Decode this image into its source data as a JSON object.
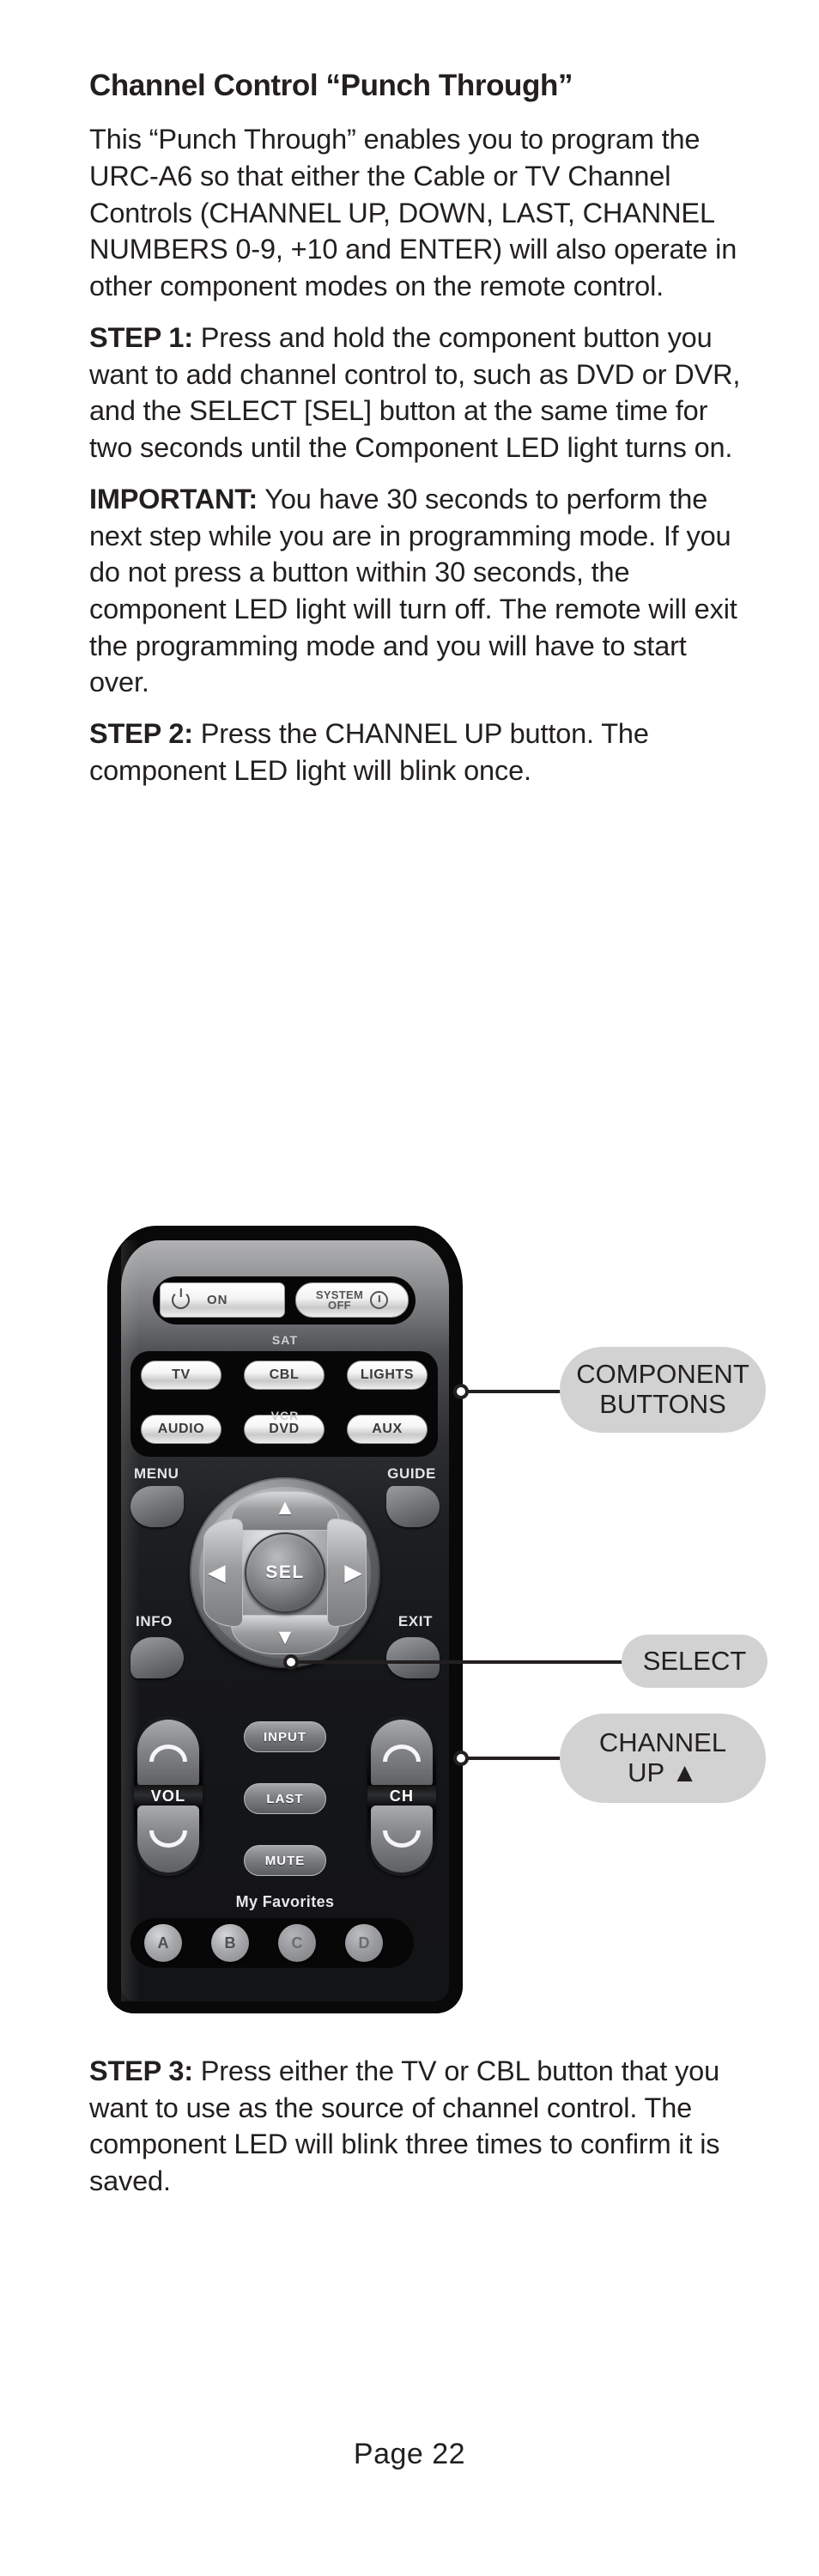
{
  "document": {
    "section_title": "Channel Control “Punch Through”",
    "paragraphs": [
      {
        "id": "intro",
        "lead": "",
        "text": "This “Punch Through” enables you to program the URC-A6 so that either the Cable or TV Channel Controls (CHANNEL UP, DOWN, LAST, CHANNEL NUMBERS 0-9, +10 and ENTER) will also operate in other component modes on the remote control."
      },
      {
        "id": "step1",
        "lead": "STEP 1:",
        "text": " Press and hold the component button you want to add channel control to, such as DVD or DVR, and the SELECT [SEL] button at the same time for two seconds until the Component LED light turns on."
      },
      {
        "id": "important",
        "lead": "IMPORTANT:",
        "text": " You have 30 seconds to perform the next step while you are in programming mode. If you do not press a button within 30 seconds, the component LED light will turn off. The remote will exit the programming mode and you will have to start over."
      },
      {
        "id": "step2",
        "lead": "STEP 2:",
        "text": " Press the CHANNEL UP button. The component LED light will blink once."
      },
      {
        "id": "step3",
        "lead": "STEP 3:",
        "text": " Press either the TV or CBL button that you want to use as the source of channel control. The component LED will blink three times to confirm it is saved."
      }
    ],
    "page_number": "Page 22"
  },
  "figure": {
    "remote": {
      "power_row": {
        "on_label": "ON",
        "system_off_line1": "SYSTEM",
        "system_off_line2": "OFF"
      },
      "sat_label": "SAT",
      "vcr_label": "VCR",
      "component_buttons": [
        "TV",
        "CBL",
        "LIGHTS",
        "AUDIO",
        "DVD",
        "AUX"
      ],
      "menu_label": "MENU",
      "guide_label": "GUIDE",
      "info_label": "INFO",
      "exit_label": "EXIT",
      "select_label": "SEL",
      "vol_label": "VOL",
      "ch_label": "CH",
      "middle_buttons": [
        "INPUT",
        "LAST",
        "MUTE"
      ],
      "favorites_label": "My Favorites",
      "favorites_buttons": [
        "A",
        "B",
        "C",
        "D"
      ]
    },
    "callouts": [
      {
        "id": "component",
        "line1": "COMPONENT",
        "line2": "BUTTONS"
      },
      {
        "id": "select",
        "line1": "SELECT",
        "line2": ""
      },
      {
        "id": "channel_up",
        "line1": "CHANNEL",
        "line2": "UP ▲"
      }
    ]
  },
  "colors": {
    "text": "#231f20",
    "bubble_fill": "#d2d2d2",
    "remote_body": "#090909",
    "page_background": "#ffffff"
  }
}
